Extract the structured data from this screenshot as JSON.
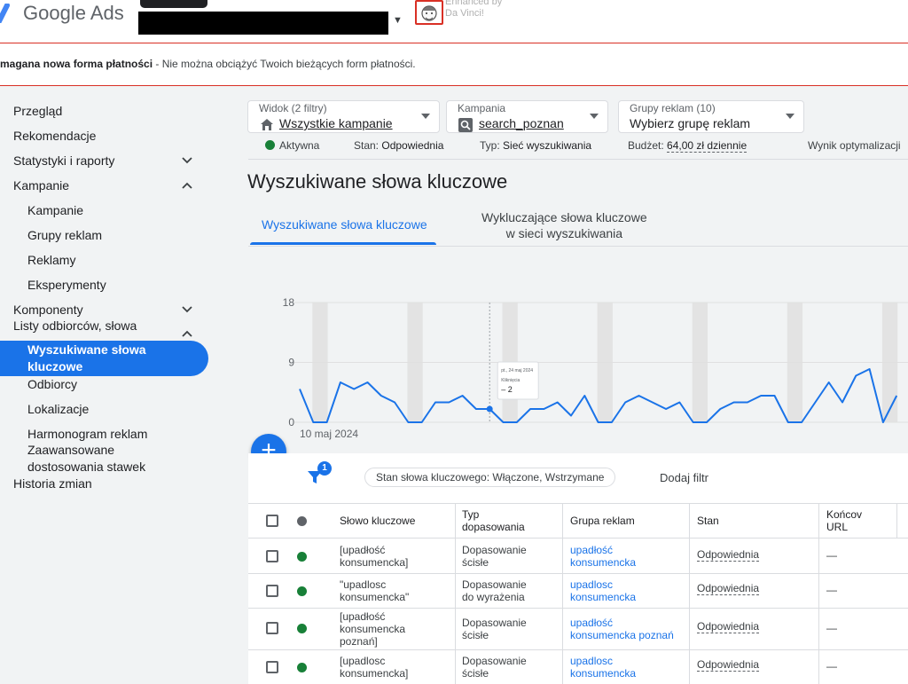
{
  "header": {
    "app_name_brand": "Google",
    "app_name_product": "Ads",
    "extension_text_line1": "Enhanced by",
    "extension_text_line2": "Da Vinci!"
  },
  "alert": {
    "bold": "magana nowa forma płatności",
    "text": " - Nie można obciążyć Twoich bieżących form płatności."
  },
  "sidebar": {
    "items": [
      {
        "label": "Przegląd"
      },
      {
        "label": "Rekomendacje"
      },
      {
        "label": "Statystyki i raporty"
      },
      {
        "label": "Kampanie"
      },
      {
        "label": "Kampanie"
      },
      {
        "label": "Grupy reklam"
      },
      {
        "label": "Reklamy"
      },
      {
        "label": "Eksperymenty"
      },
      {
        "label": "Komponenty"
      },
      {
        "label": "Listy odbiorców, słowa"
      },
      {
        "label": "Wyszukiwane słowa kluczowe"
      },
      {
        "label": "Odbiorcy"
      },
      {
        "label": "Lokalizacje"
      },
      {
        "label": "Harmonogram reklam"
      },
      {
        "label": "Zaawansowane dostosowania stawek"
      },
      {
        "label": "Historia zmian"
      }
    ],
    "active_line1": "Wyszukiwane słowa",
    "active_line2": "kluczowe",
    "adv_line1": "Zaawansowane",
    "adv_line2": "dostosowania stawek"
  },
  "filters": {
    "view_label": "Widok (2 filtry)",
    "view_value": "Wszystkie kampanie",
    "campaign_label": "Kampania",
    "campaign_value": "search_poznan",
    "adgroups_label": "Grupy reklam (10)",
    "adgroups_value": "Wybierz grupę reklam"
  },
  "status": {
    "active": "Aktywna",
    "state_label": "Stan:",
    "state_value": "Odpowiednia",
    "type_label": "Typ:",
    "type_value": "Sieć wyszukiwania",
    "budget_label": "Budżet:",
    "budget_value": "64,00 zł dziennie",
    "opt_label": "Wynik optymalizacji"
  },
  "page_title": "Wyszukiwane słowa kluczowe",
  "tabs": [
    {
      "label": "Wyszukiwane słowa kluczowe"
    },
    {
      "label_line1": "Wykluczające słowa kluczowe",
      "label_line2": "w sieci wyszukiwania"
    }
  ],
  "chart_data": {
    "type": "line",
    "y_ticks": [
      "18",
      "9",
      "0"
    ],
    "ylim": [
      0,
      18
    ],
    "x_start_label": "10 maj 2024",
    "tooltip": {
      "date": "pt., 24 maj 2024",
      "metric": "Kliknięcia",
      "value": "– 2"
    },
    "values": [
      5,
      0,
      0,
      6,
      5,
      6,
      4,
      3,
      0,
      0,
      3,
      3,
      4,
      2,
      2,
      0,
      0,
      2,
      2,
      3,
      1,
      4,
      0,
      0,
      3,
      4,
      3,
      2,
      3,
      0,
      0,
      2,
      3,
      3,
      4,
      4,
      0,
      0,
      3,
      6,
      3,
      7,
      8,
      0,
      4
    ],
    "series_color": "#1a73e8",
    "weekend_band_color": "#e3e3e3"
  },
  "filter_bar": {
    "badge": "1",
    "chip": "Stan słowa kluczowego: Włączone, Wstrzymane",
    "add_filter": "Dodaj filtr"
  },
  "table": {
    "headers": {
      "keyword": "Słowo kluczowe",
      "match_type_l1": "Typ",
      "match_type_l2": "dopasowania",
      "adgroup": "Grupa reklam",
      "state": "Stan",
      "final_url_l1": "Końcov",
      "final_url_l2": "URL"
    },
    "rows": [
      {
        "kw1": "[upadłość",
        "kw2": "konsumencka]",
        "kw3": "",
        "mt1": "Dopasowanie",
        "mt2": "ścisłe",
        "ag1": "upadłość",
        "ag2": "konsumencka",
        "state": "Odpowiednia",
        "url": "—"
      },
      {
        "kw1": "\"upadlosc",
        "kw2": "konsumencka\"",
        "kw3": "",
        "mt1": "Dopasowanie",
        "mt2": "do wyrażenia",
        "ag1": "upadlosc",
        "ag2": "konsumencka",
        "state": "Odpowiednia",
        "url": "—"
      },
      {
        "kw1": "[upadłość",
        "kw2": "konsumencka",
        "kw3": "poznań]",
        "mt1": "Dopasowanie",
        "mt2": "ścisłe",
        "ag1": "upadłość",
        "ag2": "konsumencka poznań",
        "state": "Odpowiednia",
        "url": "—"
      },
      {
        "kw1": "[upadlosc",
        "kw2": "konsumencka]",
        "kw3": "",
        "mt1": "Dopasowanie",
        "mt2": "ścisłe",
        "ag1": "upadlosc",
        "ag2": "konsumencka",
        "state": "Odpowiednia",
        "url": "—"
      }
    ],
    "status_color": "#188038"
  }
}
